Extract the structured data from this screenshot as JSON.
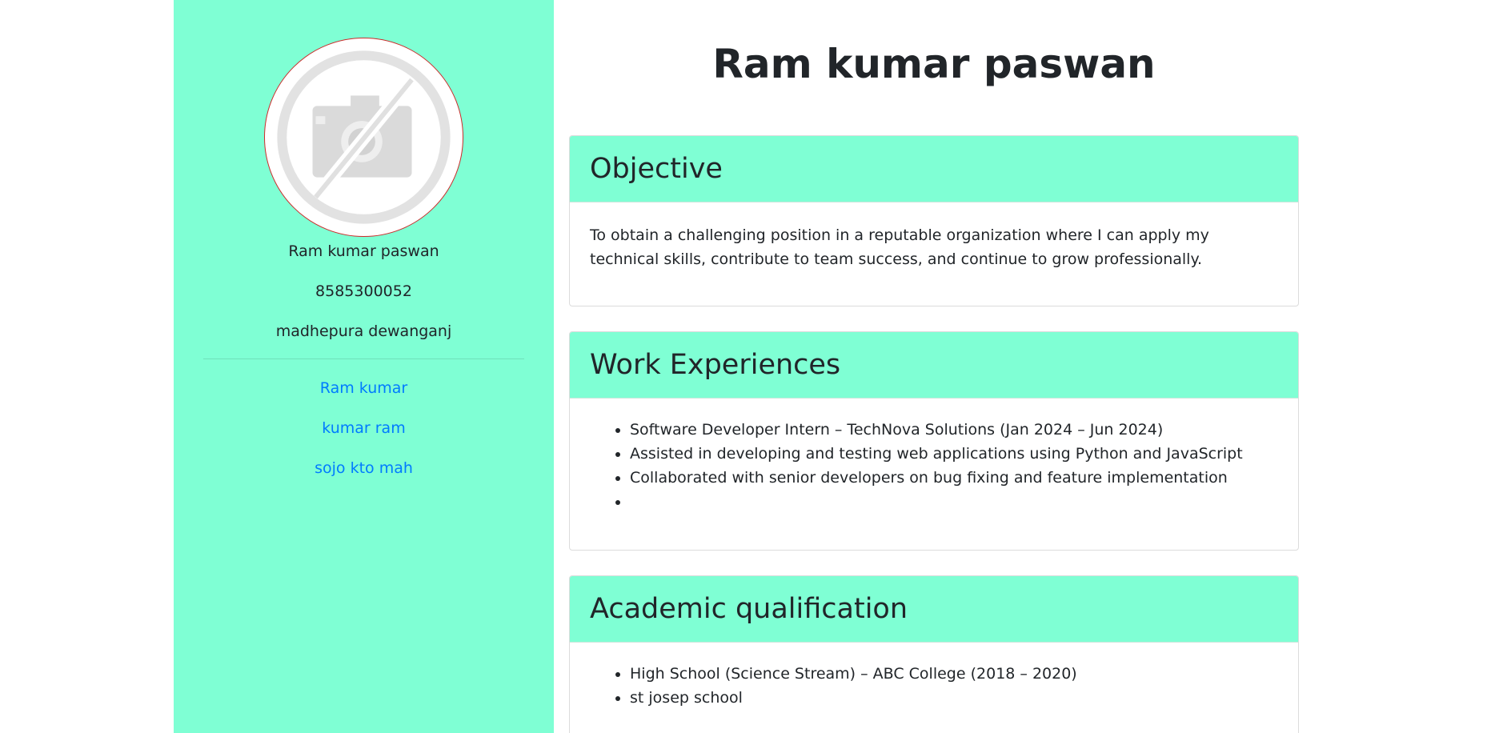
{
  "profile": {
    "name": "Ram kumar paswan",
    "phone": "8585300052",
    "address": "madhepura dewanganj",
    "avatar_icon": "no-photo-camera-icon",
    "links": [
      {
        "label": "Ram kumar"
      },
      {
        "label": "kumar ram"
      },
      {
        "label": "sojo kto mah"
      }
    ]
  },
  "main": {
    "title": "Ram kumar paswan",
    "objective": {
      "heading": "Objective",
      "text": "To obtain a challenging position in a reputable organization where I can apply my technical skills, contribute to team success, and continue to grow professionally."
    },
    "work": {
      "heading": "Work Experiences",
      "items": [
        "Software Developer Intern – TechNova Solutions (Jan 2024 – Jun 2024)",
        "Assisted in developing and testing web applications using Python and JavaScript",
        "Collaborated with senior developers on bug fixing and feature implementation",
        ""
      ]
    },
    "academic": {
      "heading": "Academic qualification",
      "items": [
        "High School (Science Stream) – ABC College (2018 – 2020)",
        "st josep school"
      ]
    }
  },
  "colors": {
    "accent": "#7fffd4",
    "link": "#007bff",
    "avatar_border": "#cc2b2b",
    "text": "#212529"
  }
}
